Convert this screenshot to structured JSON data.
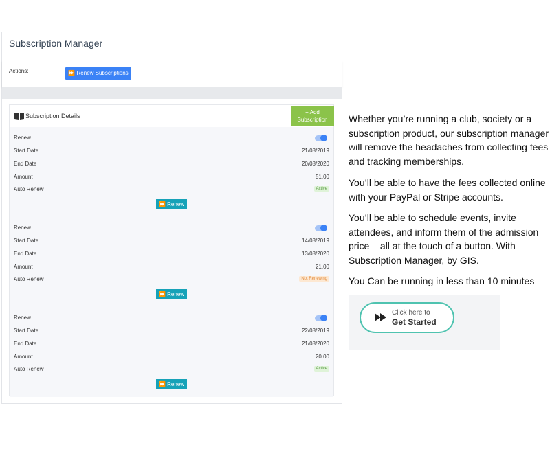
{
  "app": {
    "title": "Subscription Manager",
    "actions_label": "Actions:",
    "renew_subscriptions_label": "⏩ Renew Subscriptions",
    "details_title": "Subscription Details",
    "add_subscription_label_1": "+ Add",
    "add_subscription_label_2": "Subscription",
    "toggle_color": "#3b82f6"
  },
  "subscriptions": [
    {
      "renew_label": "Renew",
      "renew_on": true,
      "start_label": "Start Date",
      "start_value": "21/08/2019",
      "end_label": "End Date",
      "end_value": "20/08/2020",
      "amount_label": "Amount",
      "amount_value": "51.00",
      "auto_label": "Auto Renew",
      "auto_status": "Active",
      "button_label": "⏩ Renew"
    },
    {
      "renew_label": "Renew",
      "renew_on": true,
      "start_label": "Start Date",
      "start_value": "14/08/2019",
      "end_label": "End Date",
      "end_value": "13/08/2020",
      "amount_label": "Amount",
      "amount_value": "21.00",
      "auto_label": "Auto Renew",
      "auto_status": "Not Renewing",
      "button_label": "⏩ Renew"
    },
    {
      "renew_label": "Renew",
      "renew_on": true,
      "start_label": "Start Date",
      "start_value": "22/08/2019",
      "end_label": "End Date",
      "end_value": "21/08/2020",
      "amount_label": "Amount",
      "amount_value": "20.00",
      "auto_label": "Auto Renew",
      "auto_status": "Active",
      "button_label": "⏩ Renew"
    }
  ],
  "promo": {
    "paragraph_1": "Whether you’re running a club, society or a subscription product, our subscription manager will remove the headaches from collecting fees and tracking memberships.",
    "paragraph_2": "You’ll be able to have the fees collected online with your PayPal or Stripe accounts.",
    "paragraph_3": "You’ll be able to schedule events, invite attendees, and inform them of the admission price – all at the touch of a button. With Subscription Manager, by GIS.",
    "paragraph_4": "You Can be running in less than 10 minutes",
    "cta_small": "Click here to",
    "cta_big": "Get Started",
    "cta_icon": "fast-forward-icon",
    "cta_border_color": "#4fc3b0"
  }
}
